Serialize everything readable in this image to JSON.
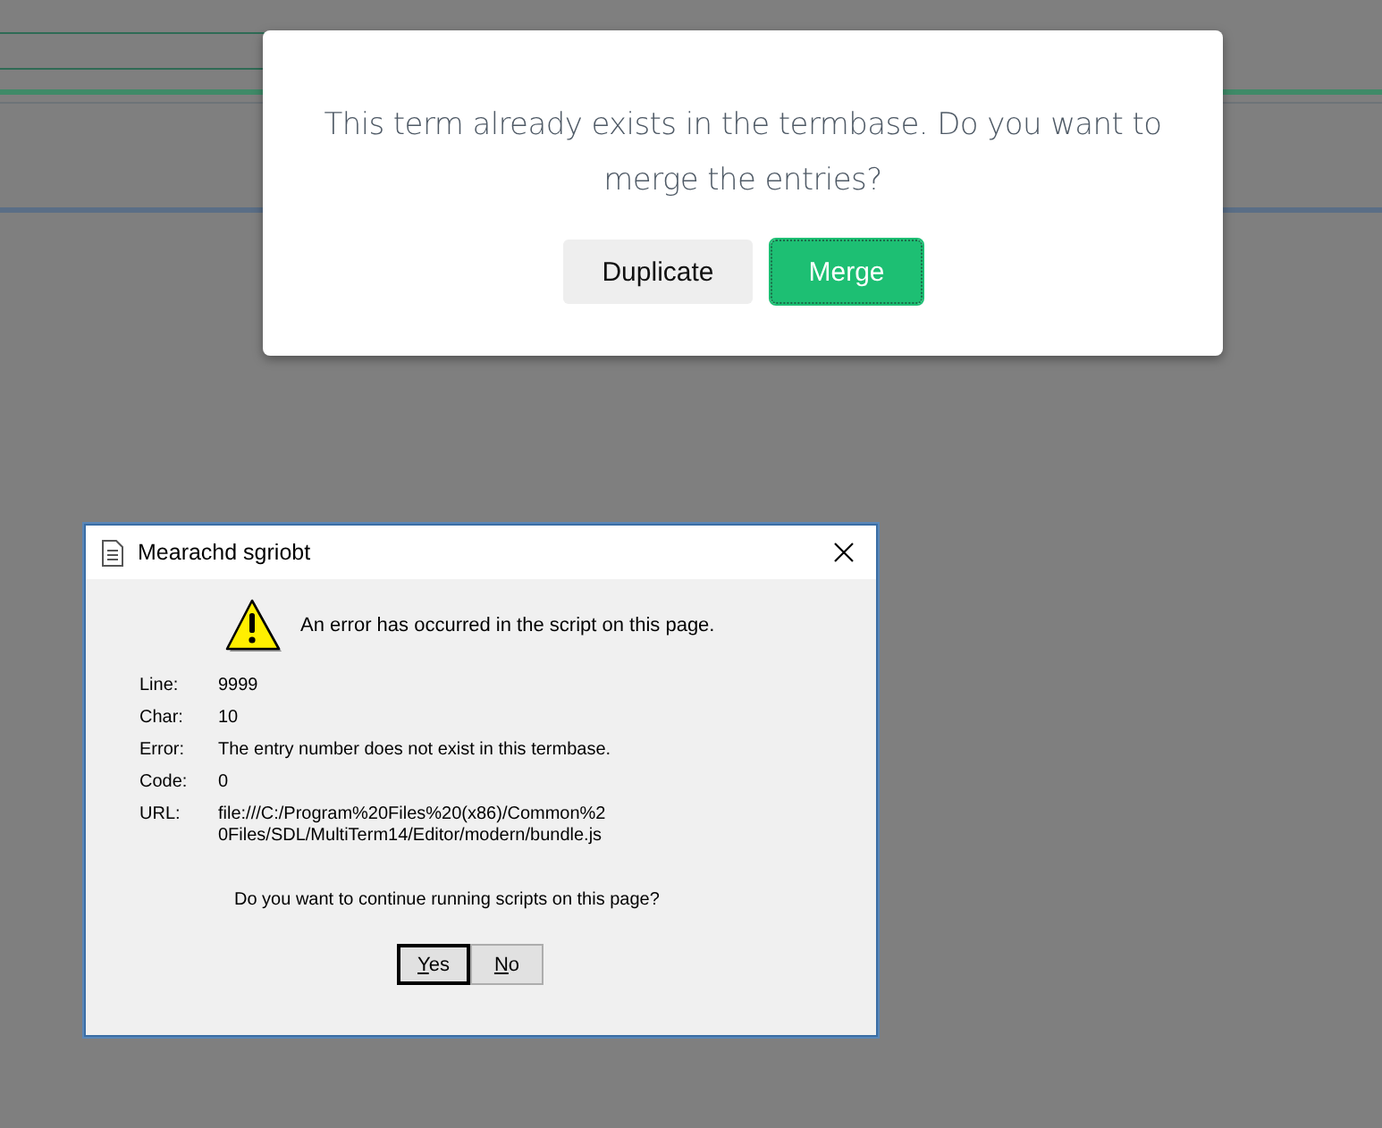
{
  "merge_dialog": {
    "message": "This term already exists in the termbase. Do you want to merge the entries?",
    "buttons": [
      {
        "label": "Duplicate",
        "kind": "secondary",
        "focused": false
      },
      {
        "label": "Merge",
        "kind": "primary",
        "focused": true
      }
    ]
  },
  "script_error_window": {
    "title": "Mearachd sgriobt",
    "heading": "An error has occurred in the script on this page.",
    "fields": [
      {
        "label": "Line:",
        "value": "9999"
      },
      {
        "label": "Char:",
        "value": "10"
      },
      {
        "label": "Error:",
        "value": "The entry number does not exist in this termbase."
      },
      {
        "label": "Code:",
        "value": "0"
      },
      {
        "label": "URL:",
        "value": "file:///C:/Program%20Files%20(x86)/Common%20Files/SDL/MultiTerm14/Editor/modern/bundle.js"
      }
    ],
    "question": "Do you want to continue running scripts on this page?",
    "buttons": [
      {
        "label": "Yes",
        "default": true
      },
      {
        "label": "No",
        "default": false
      }
    ]
  }
}
